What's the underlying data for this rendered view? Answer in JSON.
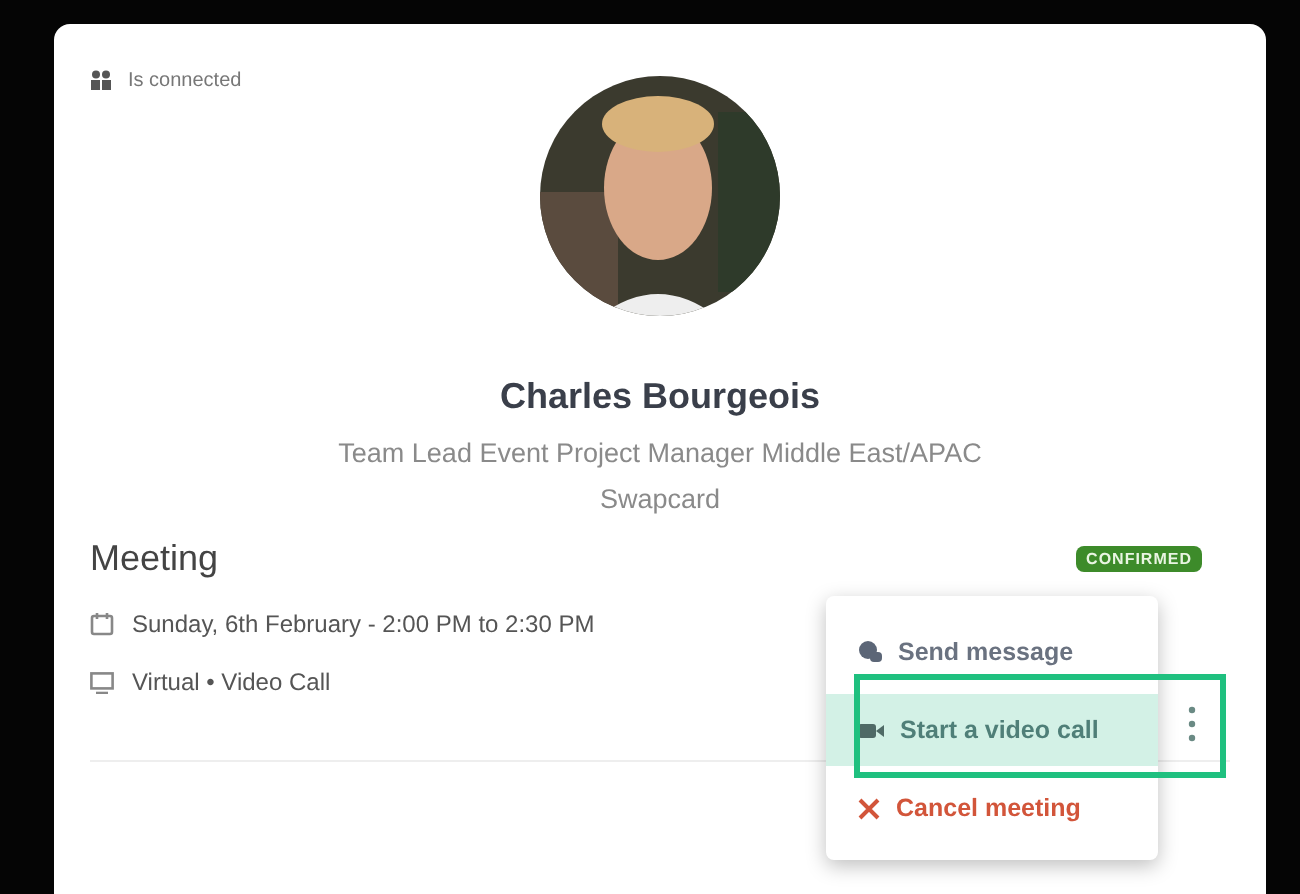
{
  "connection": {
    "label": "Is connected"
  },
  "profile": {
    "name": "Charles Bourgeois",
    "job_title": "Team Lead Event Project Manager Middle East/APAC",
    "company": "Swapcard"
  },
  "meeting": {
    "title": "Meeting",
    "status": "CONFIRMED",
    "details": [
      {
        "kind": "date",
        "text": "Sunday, 6th February - 2:00 PM to 2:30 PM"
      },
      {
        "kind": "location",
        "text": "Virtual • Video Call"
      }
    ]
  },
  "menu": {
    "items": [
      {
        "kind": "message",
        "label": "Send message",
        "selected": false
      },
      {
        "kind": "video",
        "label": "Start a video call",
        "selected": true
      },
      {
        "kind": "cancel",
        "label": "Cancel meeting",
        "selected": false
      }
    ]
  }
}
